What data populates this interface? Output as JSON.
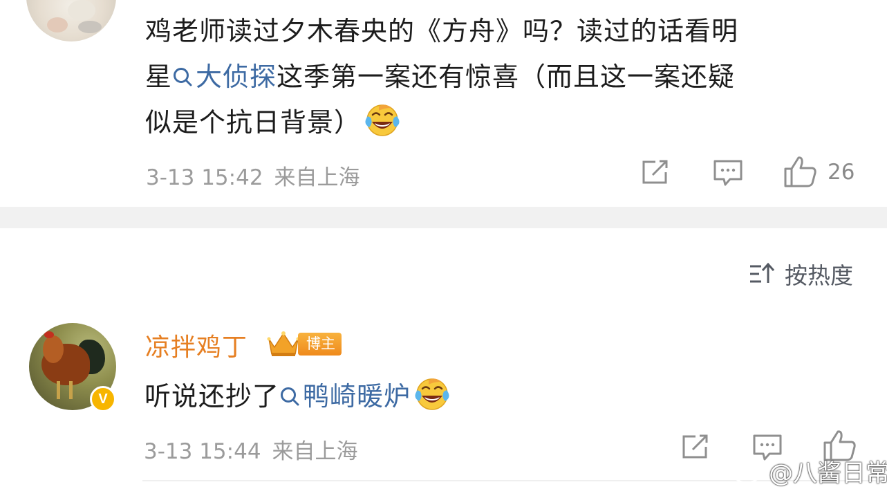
{
  "comment1": {
    "line1": "鸡老师读过夕木春央的《方舟》吗？读过的话看明",
    "line2_prefix": "星",
    "line2_topic": "大侦探",
    "line2_suffix": "这季第一案还有惊喜（而且这一案还疑",
    "line3": "似是个抗日背景）",
    "emoji_name": "laugh-cry-emoji",
    "time": "3-13 15:42",
    "source": "来自上海",
    "like_count": "26"
  },
  "sort": {
    "label": "按热度",
    "icon": "sort-icon"
  },
  "comment2": {
    "username": "凉拌鸡丁",
    "badge": "博主",
    "verified_mark": "V",
    "text_prefix": "听说还抄了",
    "topic": "鸭崎暖炉",
    "emoji_name": "laugh-cry-emoji",
    "time": "3-13 15:44",
    "source": "来自上海"
  },
  "watermark": {
    "text": "@八酱日常"
  },
  "colors": {
    "topic_link": "#3d6aa3",
    "username": "#e67f22",
    "meta": "#9b9b9b",
    "badge": "#f0931f",
    "verified": "#f7b500"
  }
}
